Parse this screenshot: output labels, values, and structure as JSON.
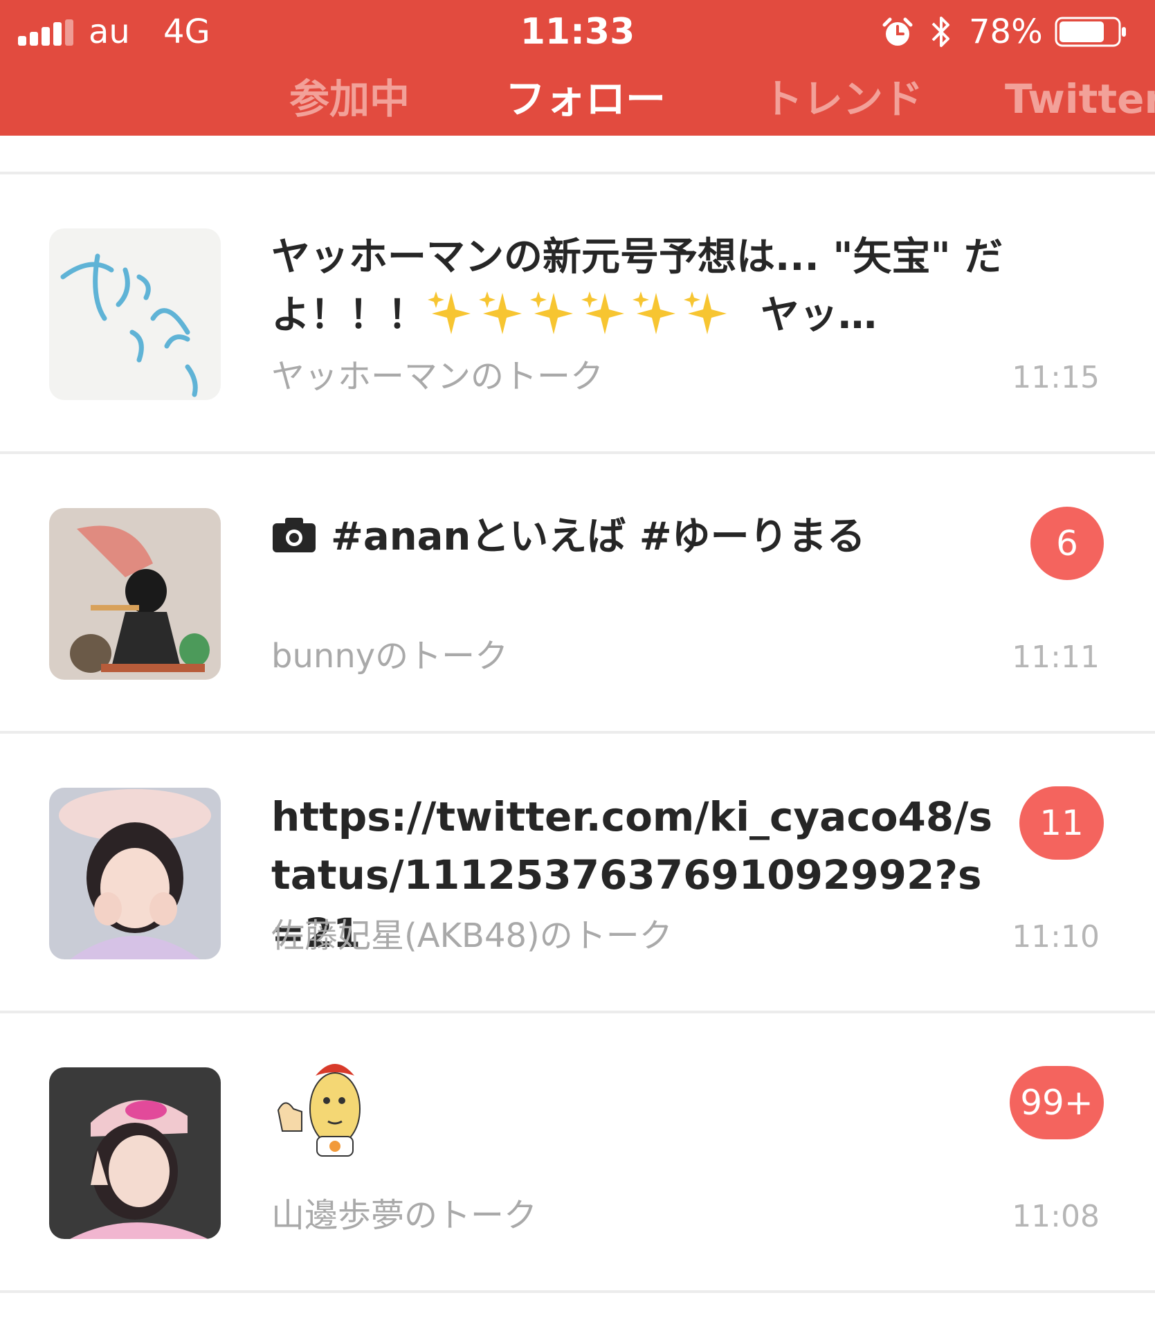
{
  "status_bar": {
    "carrier": "au",
    "network": "4G",
    "time": "11:33",
    "battery_percent": "78%",
    "battery_level": 0.78,
    "icons": [
      "signal-icon",
      "alarm-icon",
      "bluetooth-icon",
      "battery-icon"
    ]
  },
  "tabs": [
    {
      "label": "参加中",
      "active": false
    },
    {
      "label": "フォロー",
      "active": true
    },
    {
      "label": "トレンド",
      "active": false
    },
    {
      "label": "Twitter",
      "active": false
    }
  ],
  "colors": {
    "header": "#e24b3f",
    "badge": "#f4645e",
    "inactive_tab": "#f2a199"
  },
  "rows": [
    {
      "message_prefix": "ヤッホーマンの新元号予想は... \"矢宝\" だよ！！！",
      "message_suffix": "ヤッ…",
      "emoji": "sparkles-emoji",
      "room": "ヤッホーマンのトーク",
      "time": "11:15",
      "badge": ""
    },
    {
      "message": "#ananといえば  #ゆーりまる",
      "icon": "camera-icon",
      "room": "bunnyのトーク",
      "time": "11:11",
      "badge": "6"
    },
    {
      "message": "https://twitter.com/ki_cyaco48/status/1112537637691092992?s=21",
      "room": "佐藤妃星(AKB48)のトーク",
      "time": "11:10",
      "badge": "11"
    },
    {
      "message": "",
      "sticker": "thumbs-up-sticker",
      "room": "山邊歩夢のトーク",
      "time": "11:08",
      "badge": "99+"
    }
  ]
}
